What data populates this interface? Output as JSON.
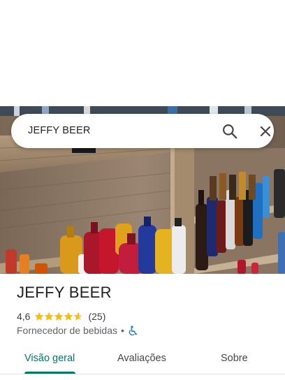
{
  "search": {
    "query": "JEFFY BEER",
    "search_icon": "search-icon",
    "close_icon": "close-icon"
  },
  "place": {
    "photo": "store-shelves-photo",
    "name": "JEFFY BEER",
    "rating": "4,6",
    "rating_fraction": 0.92,
    "reviews": "(25)",
    "category": "Fornecedor de bebidas",
    "separator": "•",
    "accessibility_icon": "wheelchair-icon"
  },
  "tabs": [
    {
      "label": "Visão geral",
      "active": true
    },
    {
      "label": "Avaliações",
      "active": false
    },
    {
      "label": "Sobre",
      "active": false
    }
  ],
  "colors": {
    "accent": "#00796b",
    "star": "#fbbc04",
    "accessibility": "#1a73e8"
  }
}
